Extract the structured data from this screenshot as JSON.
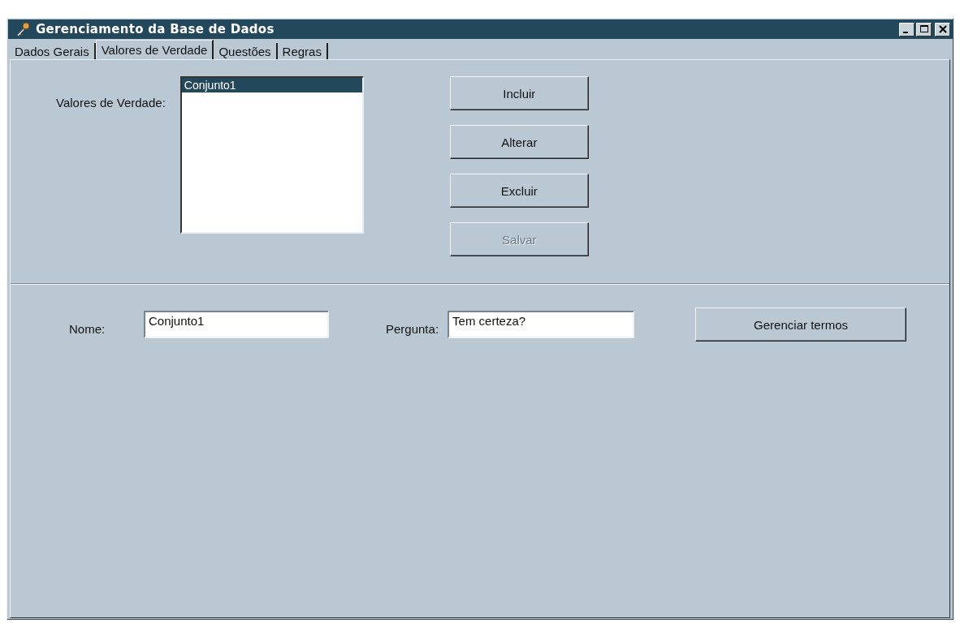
{
  "window": {
    "title": "Gerenciamento da Base de Dados"
  },
  "tabs": [
    {
      "label": "Dados Gerais",
      "selected": false
    },
    {
      "label": "Valores de Verdade",
      "selected": true
    },
    {
      "label": "Questões",
      "selected": false
    },
    {
      "label": "Regras",
      "selected": false
    }
  ],
  "truth_values": {
    "label": "Valores de Verdade:",
    "items": [
      {
        "text": "Conjunto1",
        "selected": true
      }
    ],
    "buttons": [
      {
        "label": "Incluir",
        "disabled": false
      },
      {
        "label": "Alterar",
        "disabled": false
      },
      {
        "label": "Excluir",
        "disabled": false
      },
      {
        "label": "Salvar",
        "disabled": true
      }
    ]
  },
  "details": {
    "fields": [
      {
        "label": "Nome:",
        "value": "Conjunto1"
      },
      {
        "label": "Pergunta:",
        "value": "Tem certeza?"
      }
    ],
    "button": "Gerenciar termos"
  }
}
